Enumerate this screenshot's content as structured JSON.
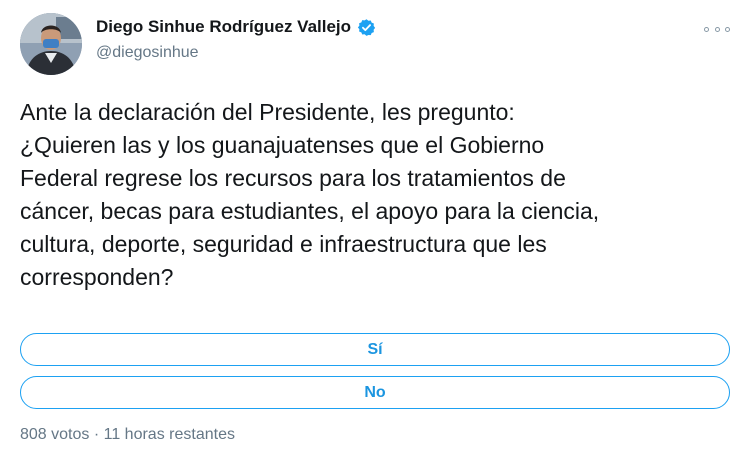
{
  "author": {
    "display_name": "Diego Sinhue Rodríguez Vallejo",
    "handle": "@diegosinhue",
    "verified": true,
    "avatar_icon": "profile-photo",
    "verified_icon": "verified-badge-icon"
  },
  "tweet": {
    "lines": [
      "Ante la declaración del Presidente, les pregunto:",
      "¿Quieren las y los guanajuatenses que el Gobierno",
      "Federal regrese los recursos para los tratamientos de",
      "cáncer, becas para estudiantes, el apoyo para la ciencia,",
      "cultura, deporte, seguridad e infraestructura que les",
      "corresponden?"
    ]
  },
  "poll": {
    "options": [
      {
        "label": "Sí"
      },
      {
        "label": "No"
      }
    ],
    "votes": "808 votos",
    "separator": "·",
    "time_left": "11 horas restantes"
  },
  "menu": {
    "icon": "more-options-icon"
  },
  "colors": {
    "accent": "#1da1f2",
    "accent_text": "#1b95e0",
    "text": "#14171a",
    "secondary_text": "#657786"
  }
}
